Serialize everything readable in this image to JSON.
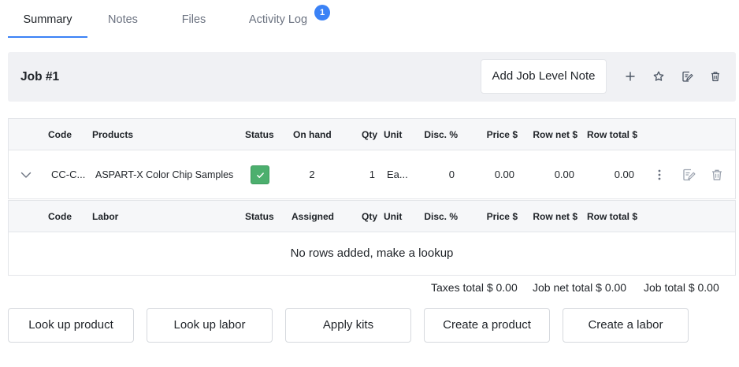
{
  "tabs": [
    {
      "label": "Summary",
      "active": true
    },
    {
      "label": "Notes",
      "active": false
    },
    {
      "label": "Files",
      "active": false
    },
    {
      "label": "Activity Log",
      "active": false,
      "badge": "1"
    }
  ],
  "job": {
    "title": "Job #1",
    "add_note_label": "Add Job Level Note",
    "icons": [
      "plus-icon",
      "star-icon",
      "edit-note-icon",
      "trash-icon"
    ]
  },
  "products_table": {
    "headers": {
      "code": "Code",
      "name": "Products",
      "status": "Status",
      "on_hand": "On hand",
      "qty": "Qty",
      "unit": "Unit",
      "disc": "Disc. %",
      "price": "Price $",
      "row_net": "Row net $",
      "row_total": "Row total $"
    },
    "rows": [
      {
        "code": "CC-C...",
        "name": "ASPART-X Color Chip Samples",
        "status": "checked",
        "on_hand": "2",
        "qty": "1",
        "unit": "Ea...",
        "disc": "0",
        "price": "0.00",
        "row_net": "0.00",
        "row_total": "0.00"
      }
    ]
  },
  "labor_table": {
    "headers": {
      "code": "Code",
      "name": "Labor",
      "status": "Status",
      "assigned": "Assigned",
      "qty": "Qty",
      "unit": "Unit",
      "disc": "Disc. %",
      "price": "Price $",
      "row_net": "Row net $",
      "row_total": "Row total $"
    },
    "empty_message": "No rows added, make a lookup"
  },
  "totals": {
    "taxes": "Taxes total $ 0.00",
    "job_net": "Job net total $ 0.00",
    "job_total": "Job total $ 0.00"
  },
  "actions": {
    "lookup_product": "Look up product",
    "lookup_labor": "Look up labor",
    "apply_kits": "Apply kits",
    "create_product": "Create a product",
    "create_labor": "Create a labor"
  },
  "colors": {
    "accent": "#3b82f6",
    "status_green": "#4caf6e",
    "header_bg": "#f0f1f4"
  }
}
